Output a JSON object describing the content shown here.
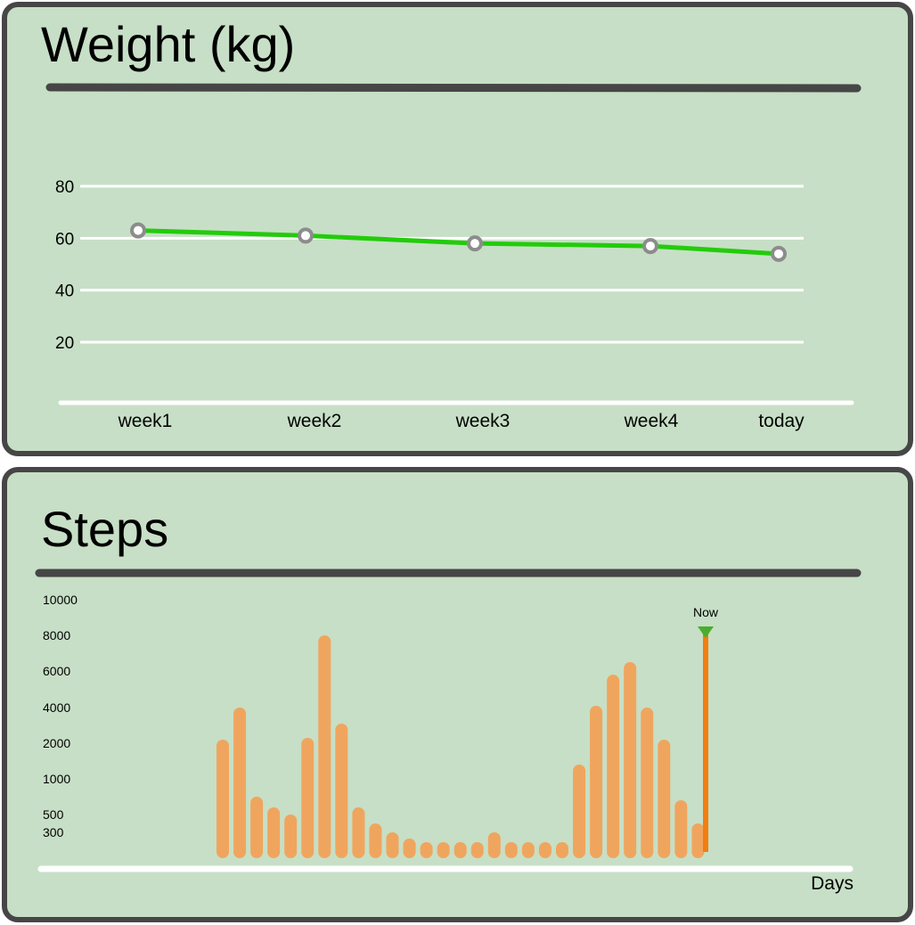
{
  "weight_panel": {
    "title": "Weight (kg)"
  },
  "steps_panel": {
    "title": "Steps",
    "now_label": "Now",
    "x_label": "Days"
  },
  "colors": {
    "panel_bg": "#c7dfc6",
    "panel_border": "#464646",
    "line": "#22cc0a",
    "marker_stroke": "#8c8c8c",
    "bar": "#f0a55e",
    "now_line": "#f47d0e",
    "now_marker": "#4aad2e",
    "grid": "#ffffff"
  },
  "chart_data": [
    {
      "type": "line",
      "title": "Weight (kg)",
      "x": [
        "week1",
        "week2",
        "week3",
        "week4",
        "today"
      ],
      "values": [
        63,
        61,
        58,
        57,
        54
      ],
      "yticks": [
        80,
        60,
        40,
        20
      ],
      "ylim": [
        0,
        80
      ],
      "grid": true
    },
    {
      "type": "bar",
      "title": "Steps",
      "xlabel": "Days",
      "yticks": [
        "10000",
        "8000",
        "6000",
        "4000",
        "2000",
        "1000",
        "500",
        "300"
      ],
      "values": [
        2200,
        4000,
        750,
        600,
        500,
        2300,
        8000,
        3100,
        600,
        400,
        300,
        200,
        100,
        100,
        100,
        100,
        300,
        100,
        100,
        100,
        100,
        1400,
        4100,
        5800,
        6500,
        4000,
        2200,
        700,
        400
      ],
      "annotation": "Now",
      "grid": false
    }
  ]
}
